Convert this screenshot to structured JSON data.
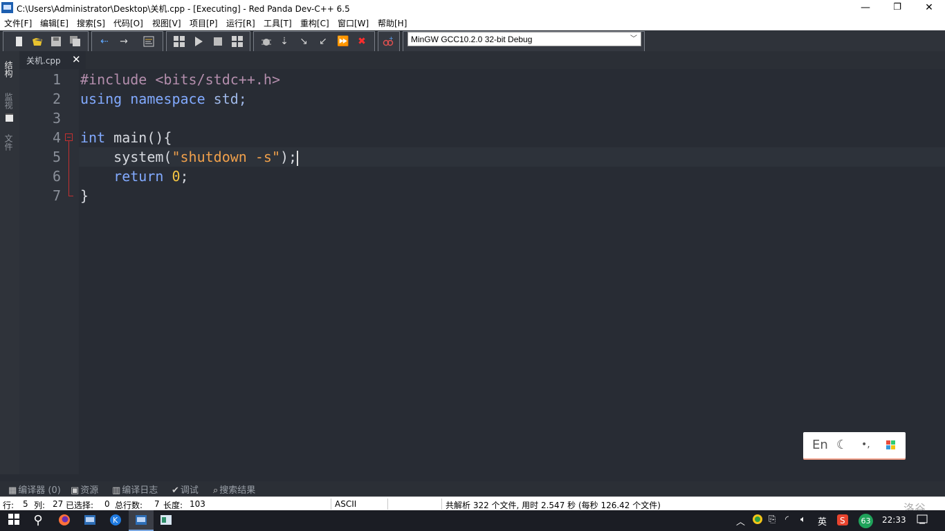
{
  "window": {
    "title": "C:\\Users\\Administrator\\Desktop\\关机.cpp - [Executing] - Red Panda Dev-C++ 6.5",
    "controls": {
      "minimize": "—",
      "maximize": "❐",
      "close": "✕"
    }
  },
  "menu": [
    "文件[F]",
    "编辑[E]",
    "搜索[S]",
    "代码[O]",
    "视图[V]",
    "项目[P]",
    "运行[R]",
    "工具[T]",
    "重构[C]",
    "窗口[W]",
    "帮助[H]"
  ],
  "toolbar": {
    "compiler": "MinGW GCC10.2.0 32-bit Debug",
    "icons": [
      "new-file-icon",
      "open-folder-icon",
      "save-icon",
      "save-all-icon",
      "back-icon",
      "forward-icon",
      "format-icon",
      "compile-icon",
      "run-icon",
      "stop-icon",
      "rebuild-icon",
      "debug-icon",
      "step-over-icon",
      "step-into-icon",
      "step-out-icon",
      "continue-icon",
      "abort-icon",
      "add-watch-icon"
    ]
  },
  "left_tabs": [
    "结构",
    "监视",
    "文件"
  ],
  "editor": {
    "tab_name": "关机.cpp",
    "tab_close": "✕",
    "line_numbers": [
      "1",
      "2",
      "3",
      "4",
      "5",
      "6",
      "7"
    ],
    "lines": {
      "l1_pre": "#include",
      "l1_hdr": " <bits/stdc++.h>",
      "l2_using": "using",
      "l2_namespace": " namespace",
      "l2_rest": " std;",
      "l4_int": "int",
      "l4_rest": " main(){",
      "l5_indent": "    ",
      "l5_call": "system(",
      "l5_str": "\"shutdown -s\"",
      "l5_end": ");",
      "l6_indent": "    ",
      "l6_return": "return",
      "l6_space": " ",
      "l6_num": "0",
      "l6_semi": ";",
      "l7": "}"
    }
  },
  "ime": {
    "lang": "En",
    "moon": "☾",
    "punct": "•,"
  },
  "bottom_tabs": [
    "编译器 (0)",
    "资源",
    "编译日志",
    "调试",
    "搜索结果"
  ],
  "status": {
    "row_label": "行:",
    "row": "5",
    "col_label": "列:",
    "col": "27",
    "sel_label": "已选择:",
    "sel": "0",
    "total_label": "总行数:",
    "total": "7",
    "len_label": "长度:",
    "len": "103",
    "encoding": "ASCII",
    "parse_info": "共解析 322 个文件, 用时 2.547 秒 (每秒 126.42 个文件)"
  },
  "taskbar": {
    "time": "22:33",
    "ime_lang": "英",
    "badge": "63",
    "watermark": "洛谷"
  },
  "colors": {
    "editor_bg": "#282c34",
    "keyword_pre": "#b48ead",
    "keyword": "#82aaff",
    "string": "#f0a04b",
    "number": "#f5c542",
    "fold": "#c53030"
  }
}
